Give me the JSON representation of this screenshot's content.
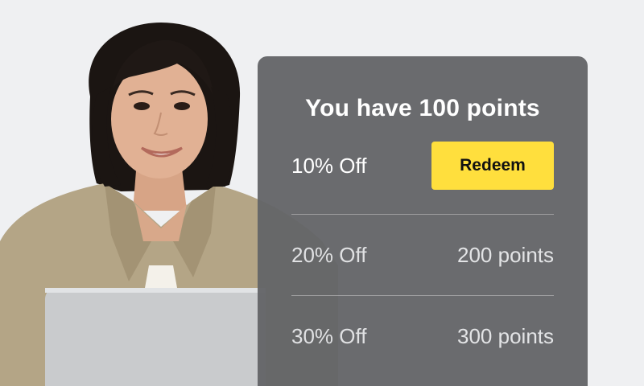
{
  "colors": {
    "background": "#eff0f2",
    "card": "#646568",
    "accent": "#ffdf3d"
  },
  "photo": {
    "icon": "person-with-laptop-photo"
  },
  "rewards": {
    "title": "You have 100 points",
    "items": [
      {
        "label": "10% Off",
        "action_label": "Redeem"
      },
      {
        "label": "20% Off",
        "cost": "200 points"
      },
      {
        "label": "30% Off",
        "cost": "300 points"
      }
    ]
  }
}
